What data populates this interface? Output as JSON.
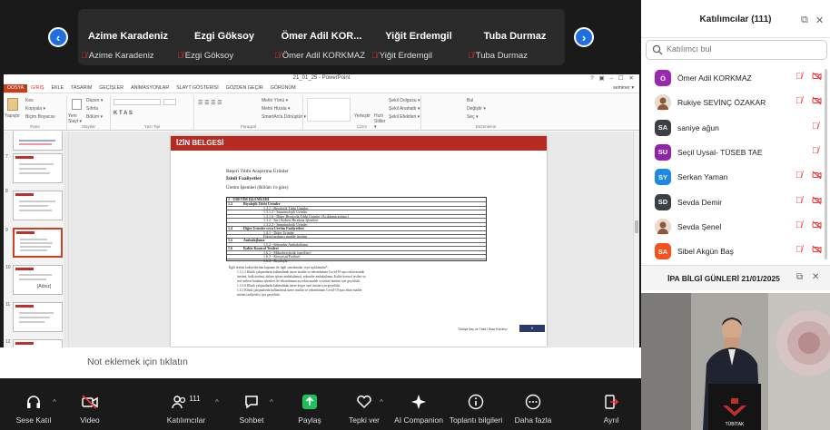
{
  "gallery": {
    "prev_icon": "chevron-left-icon",
    "next_icon": "chevron-right-icon",
    "tiles": [
      {
        "name": "Azime Karadeniz",
        "label": "Azime Karadeniz"
      },
      {
        "name": "Ezgi Göksoy",
        "label": "Ezgi Göksoy"
      },
      {
        "name": "Ömer Adil KOR...",
        "label": "Ömer Adil KORKMAZ"
      },
      {
        "name": "Yiğit Erdemgil",
        "label": "Yiğit Erdemgil"
      },
      {
        "name": "Tuba Durmaz",
        "label": "Tuba Durmaz"
      }
    ]
  },
  "ppt": {
    "title": "21_01_25 - PowerPoint",
    "window_controls": "? ▣ – ☐ ✕",
    "user": "seminer ▾",
    "menu": [
      "DOSYA",
      "GİRİŞ",
      "EKLE",
      "TASARIM",
      "GEÇİŞLER",
      "ANİMASYONLAR",
      "SLAYT GÖSTERİSİ",
      "GÖZDEN GEÇİR",
      "GÖRÜNÜM"
    ],
    "ribbon": {
      "paste": "Yapıştır",
      "cut": "Kes",
      "copy": "Kopyala ▾",
      "format_painter": "Biçim Boyacısı",
      "new_slide": "Yeni Slayt ▾",
      "layout": "Düzen ▾",
      "reset": "Sıfırla",
      "section": "Bölüm ▾",
      "text_direction": "Metin Yönü ▾",
      "align_text": "Metni Hizala ▾",
      "smartart": "SmartArt'a Dönüştür ▾",
      "arrange": "Yerleştir",
      "quick_styles": "Hızlı Stiller ▾",
      "shape_fill": "Şekil Dolgusu ▾",
      "shape_outline": "Şekil Anahattı ▾",
      "shape_effects": "Şekil Efektleri ▾",
      "find": "Bul",
      "replace": "Değiştir ▾",
      "select": "Seç ▾",
      "groups": [
        "Pano",
        "Slaytlar",
        "Yazı Tipi",
        "Paragraf",
        "Çizim",
        "Düzenleme"
      ]
    },
    "thumbnails": [
      "7",
      "8",
      "9",
      "10",
      "11",
      "12",
      "13"
    ],
    "thumb10_text": "[Adsız]",
    "slide": {
      "header": "İZİN BELGESİ",
      "line1": "Beşeri Tıbbi Araştırma Ürünler",
      "line2": "İzinli Faaliyetler",
      "line3": "Üretim İşlemleri (Bölüm 1'e göre)",
      "table_rows": [
        {
          "c1": "1 - ÜRETİM İŞLEMLERİ",
          "c2": ""
        },
        {
          "c1": "1.3",
          "c2": "Biyolojik Tıbbi Ürünler"
        },
        {
          "c1": "",
          "c2": "1.3.1 - Biyolojik Tıbbi Ürünler"
        },
        {
          "c1": "",
          "c2": "1.3.1.2 - İmmünolojik Ürünler"
        },
        {
          "c1": "",
          "c2": "1.3.1.6 - Diğer Biyolojik Tıbbi Ürünler (Açıklama giriniz.)"
        },
        {
          "c1": "",
          "c2": "1.3.2 - Seri Serbest Bırakma İşlemleri"
        },
        {
          "c1": "",
          "c2": "1.3.2.2 - İmmünolojik Ürünler"
        },
        {
          "c1": "1.4",
          "c2": "Diğer Ürünler veya Üretim Faaliyetleri"
        },
        {
          "c1": "",
          "c2": "1.4.1 - Diğer Ürünler"
        },
        {
          "c1": "",
          "c2": "Etkin/yardımcı madde üretimi"
        },
        {
          "c1": "1.5",
          "c2": "Ambalajlama"
        },
        {
          "c1": "",
          "c2": "1.5.2 - Sekonder Ambalajlama"
        },
        {
          "c1": "1.6",
          "c2": "Kalite Kontrol Testleri"
        },
        {
          "c1": "",
          "c2": "1.6.1 - Mikrobiyolojik (steril/ne)"
        },
        {
          "c1": "",
          "c2": "1.6.3 - Kimyasal/Fiziksel"
        },
        {
          "c1": "",
          "c2": "1.6.4 - Biyolojik"
        }
      ],
      "paragraphs": [
        "İlgili üretim faaliyetlerinin kapsamı ile ilgili sınırlamalar veya açıklamalar*:",
        "1.3.1.2 Klinik çalışmalarda kullanılmak üzere insülin ve rekombinant Covid-19 aşısı etkin madde",
        "üretimi, bulk üretimi, dolum işlemi ambalajlama), sekonder ambalajlama, Kalite kontrol testleri ve",
        "seri serbest bırakma işlemleri ile rekombinant aşı etkin madde ve ürünü üretimi için geçerlidir.",
        "1.3.1.6 Klinik çalışmalarda kullanılmak üzere kişiye özel üretim için geçerlidir.",
        "1.4.1 Klinik çalışmalarda kullanılmak üzere insülin ve rekombinant Covid-19 aşısı etkin madde",
        "üretim faaliyetleri için geçerlidir."
      ],
      "footer": "Türkiye İlaç ve Tıbbi Cihaz Kurumu",
      "page": "9"
    },
    "notes_placeholder": "Not eklemek için tıklatın"
  },
  "toolbar": {
    "buttons": [
      {
        "label": "Sese Katıl",
        "icon": "headphones-icon"
      },
      {
        "label": "Video",
        "icon": "video-off-icon"
      },
      {
        "label": "Katılımcılar",
        "icon": "participants-icon",
        "count": "111"
      },
      {
        "label": "Sohbet",
        "icon": "chat-icon"
      },
      {
        "label": "Paylaş",
        "icon": "share-icon"
      },
      {
        "label": "Tepki ver",
        "icon": "heart-icon"
      },
      {
        "label": "AI Companion",
        "icon": "sparkle-icon"
      },
      {
        "label": "Toplantı bilgileri",
        "icon": "info-icon"
      },
      {
        "label": "Daha fazla",
        "icon": "more-icon"
      },
      {
        "label": "Ayrıl",
        "icon": "leave-icon"
      }
    ]
  },
  "panel": {
    "title": "Katılımcılar (111)",
    "search_placeholder": "Katılımcı bul",
    "participants": [
      {
        "initials": "Ö",
        "name": "Ömer Adil KORKMAZ",
        "color": "#9b27b0",
        "mic_muted": true,
        "video_off": true
      },
      {
        "initials": "",
        "name": "Rukiye SEVİNÇ ÖZAKAR",
        "color": "#d7b59a",
        "photo": true,
        "mic_muted": true,
        "video_off": true
      },
      {
        "initials": "SA",
        "name": "saniye ağun",
        "color": "#3b3f46",
        "mic_muted": true,
        "video_off": false
      },
      {
        "initials": "SU",
        "name": "Seçil Uysal- TÜSEB TAE",
        "color": "#8e24aa",
        "mic_muted": true,
        "video_off": false
      },
      {
        "initials": "SY",
        "name": "Serkan Yaman",
        "color": "#1e88e5",
        "mic_muted": true,
        "video_off": true
      },
      {
        "initials": "SD",
        "name": "Sevda Demir",
        "color": "#3b3f46",
        "mic_muted": true,
        "video_off": true
      },
      {
        "initials": "",
        "name": "Sevda Şenel",
        "color": "#d7a67a",
        "photo": true,
        "mic_muted": true,
        "video_off": true
      },
      {
        "initials": "SA",
        "name": "Sibel Akgün Baş",
        "color": "#f4511e",
        "mic_muted": true,
        "video_off": true
      }
    ]
  },
  "video": {
    "title": "İPA BİLGİ GÜNLERİ 21/01/2025",
    "logo_text": "TÜBİTAK"
  }
}
